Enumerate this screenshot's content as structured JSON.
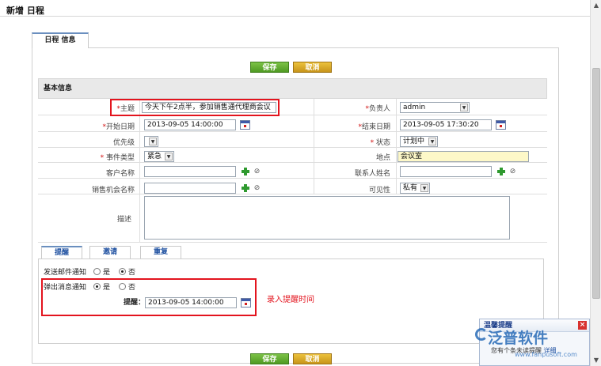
{
  "page": {
    "title": "新增 日程"
  },
  "tabs": {
    "main": "日程 信息"
  },
  "buttons": {
    "save": "保存",
    "cancel": "取消"
  },
  "section": {
    "basic": "基本信息"
  },
  "form": {
    "subject": {
      "label": "*主题",
      "value": "今天下午2点半，参加销售通代理商会议"
    },
    "owner": {
      "label": "*负责人",
      "value": "admin"
    },
    "start": {
      "label": "*开始日期",
      "value": "2013-09-05 14:00:00"
    },
    "end": {
      "label": "*结束日期",
      "value": "2013-09-05 17:30:20"
    },
    "priority": {
      "label": "优先级",
      "value": ""
    },
    "status": {
      "label": "* 状态",
      "value": "计划中"
    },
    "eventType": {
      "label": "* 事件类型",
      "value": "紧急"
    },
    "location": {
      "label": "地点",
      "value": "会议室"
    },
    "customer": {
      "label": "客户名称",
      "value": ""
    },
    "contact": {
      "label": "联系人姓名",
      "value": ""
    },
    "opportunity": {
      "label": "销售机会名称",
      "value": ""
    },
    "visibility": {
      "label": "可见性",
      "value": "私有"
    },
    "description": {
      "label": "描述",
      "value": ""
    }
  },
  "subtabs": [
    "提醒",
    "邀请",
    "重复"
  ],
  "reminder": {
    "email_label": "发送邮件通知",
    "popup_label": "弹出消息通知",
    "yes": "是",
    "no": "否",
    "remind_label": "提醒：",
    "remind_value": "2013-09-05 14:00:00",
    "annotation": "录入提醒时间"
  },
  "popup": {
    "title": "温馨提醒",
    "text_prefix": "您有",
    "text_mid": "个条未读提醒",
    "link": "详细",
    "logo": "泛普软件",
    "logo_url": "www.fanpusoft.com"
  },
  "colors": {
    "required": "#d11111",
    "annotation": "#e3141e",
    "save": "#4f9a22",
    "cancel": "#c7941a"
  }
}
